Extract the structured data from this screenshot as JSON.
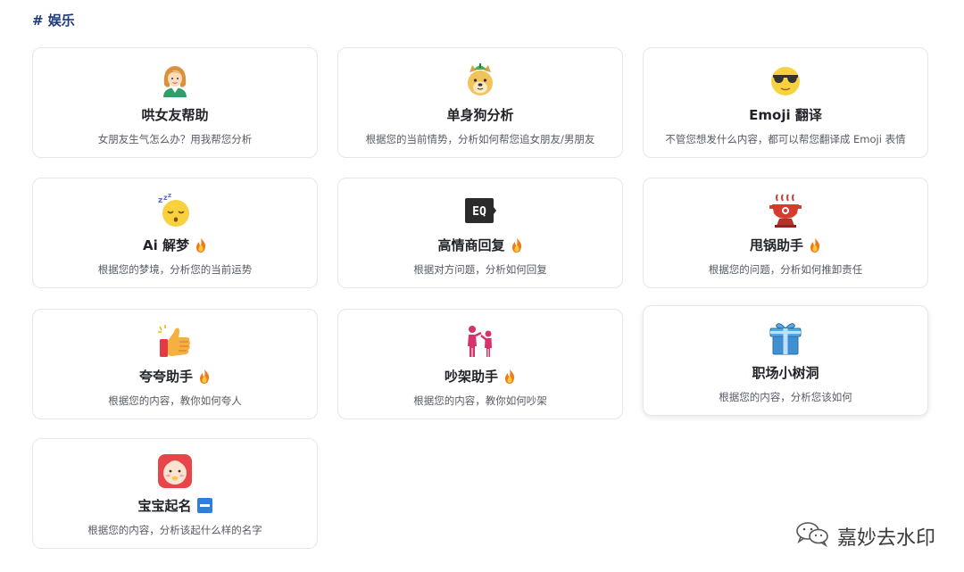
{
  "section": {
    "title": "# 娱乐"
  },
  "cards": [
    {
      "icon": "girl-avatar-icon",
      "title": "哄女友帮助",
      "desc": "女朋友生气怎么办？用我帮您分析",
      "badge": ""
    },
    {
      "icon": "doge-icon",
      "title": "单身狗分析",
      "desc": "根据您的当前情势，分析如何帮您追女朋友/男朋友",
      "badge": ""
    },
    {
      "icon": "sunglasses-face-icon",
      "title": "Emoji 翻译",
      "desc": "不管您想发什么内容，都可以帮您翻译成 Emoji 表情",
      "badge": ""
    },
    {
      "icon": "sleeping-face-icon",
      "title": "Ai 解梦",
      "desc": "根据您的梦境，分析您的当前运势",
      "badge": "fire"
    },
    {
      "icon": "eq-label-icon",
      "title": "高情商回复",
      "desc": "根据对方问题，分析如何回复",
      "badge": "fire",
      "icon_text": "EQ"
    },
    {
      "icon": "hot-pot-icon",
      "title": "甩锅助手",
      "desc": "根据您的问题，分析如何推卸责任",
      "badge": "fire"
    },
    {
      "icon": "thumbs-up-icon",
      "title": "夸夸助手",
      "desc": "根据您的内容，教你如何夸人",
      "badge": "fire"
    },
    {
      "icon": "arguing-people-icon",
      "title": "吵架助手",
      "desc": "根据您的内容，教你如何吵架",
      "badge": "fire"
    },
    {
      "icon": "gift-icon",
      "title": "职场小树洞",
      "desc": "根据您的内容，分析您该如何",
      "badge": ""
    },
    {
      "icon": "baby-face-icon",
      "title": "宝宝起名",
      "desc": "根据您的内容，分析该起什么样的名字",
      "badge": "minus"
    }
  ],
  "watermark": {
    "text": "嘉妙去水印"
  },
  "colors": {
    "accent": "#1d3a7a",
    "border": "#e4e6ea",
    "desc": "#555b63"
  }
}
